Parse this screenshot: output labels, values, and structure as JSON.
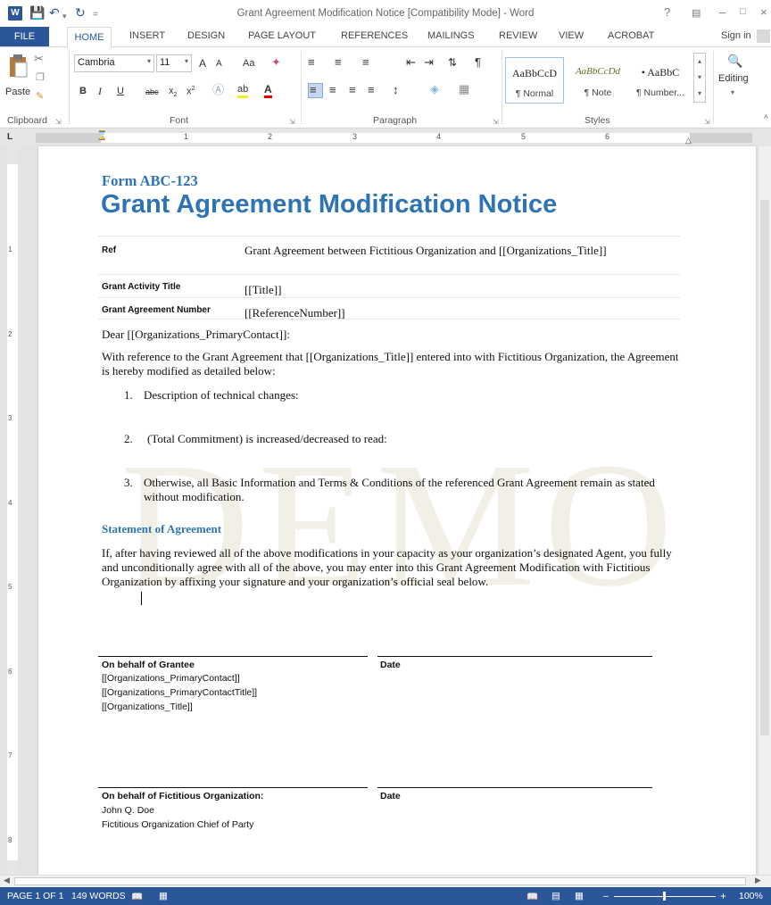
{
  "window": {
    "title": "Grant Agreement Modification Notice [Compatibility Mode] - Word",
    "help": "?",
    "app_icon": "W"
  },
  "ribbon_tabs": [
    "FILE",
    "HOME",
    "INSERT",
    "DESIGN",
    "PAGE LAYOUT",
    "REFERENCES",
    "MAILINGS",
    "REVIEW",
    "VIEW",
    "ACROBAT"
  ],
  "sign_in": "Sign in",
  "clipboard": {
    "paste": "Paste",
    "label": "Clipboard"
  },
  "font": {
    "name": "Cambria",
    "size": "11",
    "grow": "A",
    "shrink": "A",
    "case": "Aa",
    "bold": "B",
    "italic": "I",
    "underline": "U",
    "strike": "abc",
    "sub": "x",
    "sup": "x",
    "label": "Font"
  },
  "paragraph": {
    "label": "Paragraph",
    "pilcrow": "¶"
  },
  "styles": {
    "label": "Styles",
    "items": [
      {
        "preview": "AaBbCcD",
        "name": "¶ Normal"
      },
      {
        "preview": "AaBbCcDd",
        "name": "¶ Note"
      },
      {
        "preview": "• AaBbC",
        "name": "¶ Number..."
      }
    ]
  },
  "editing": {
    "label": "Editing"
  },
  "ruler_numbers": [
    "1",
    "2",
    "3",
    "4",
    "5",
    "6"
  ],
  "vruler_numbers": [
    "1",
    "2",
    "3",
    "4",
    "5",
    "6",
    "7",
    "8"
  ],
  "document": {
    "form_code": "Form ABC-123",
    "title": "Grant Agreement Modification Notice",
    "table": [
      {
        "label": "Ref",
        "value": "Grant Agreement between Fictitious Organization and [[Organizations_Title]]"
      },
      {
        "label": "Grant Activity Title",
        "value": "[[Title]]"
      },
      {
        "label": "Grant Agreement Number",
        "value": "[[ReferenceNumber]]"
      }
    ],
    "salutation": "Dear [[Organizations_PrimaryContact]]:",
    "intro": "With reference to the Grant Agreement that [[Organizations_Title]] entered into with Fictitious Organization, the Agreement is hereby modified as detailed below:",
    "items": [
      {
        "num": "1.",
        "text": "Description of technical changes:"
      },
      {
        "num": "2.",
        "text": "(Total Commitment) is increased/decreased to read:"
      },
      {
        "num": "3.",
        "text": "Otherwise, all Basic Information and Terms & Conditions of the referenced Grant Agreement remain as stated without modification."
      }
    ],
    "statement_heading": "Statement of Agreement",
    "statement_body": "If, after having reviewed all of the above modifications in your capacity as your organization’s designated Agent, you fully and unconditionally agree with all of the above, you may enter into this Grant Agreement Modification with Fictitious Organization by affixing your signature and your organization’s official seal below.",
    "watermark": "DEMO",
    "grantee": {
      "heading": "On behalf of Grantee",
      "date": "Date",
      "lines": [
        "[[Organizations_PrimaryContact]]",
        "[[Organizations_PrimaryContactTitle]]",
        "[[Organizations_Title]]"
      ]
    },
    "org": {
      "heading": "On behalf of Fictitious Organization:",
      "date": "Date",
      "lines": [
        "John Q. Doe",
        "Fictitious Organization Chief of Party"
      ]
    }
  },
  "status": {
    "page": "PAGE 1 OF 1",
    "words": "149 WORDS",
    "zoom": "100%"
  },
  "colors": {
    "accent": "#2b579a",
    "heading": "#2e74b5"
  }
}
